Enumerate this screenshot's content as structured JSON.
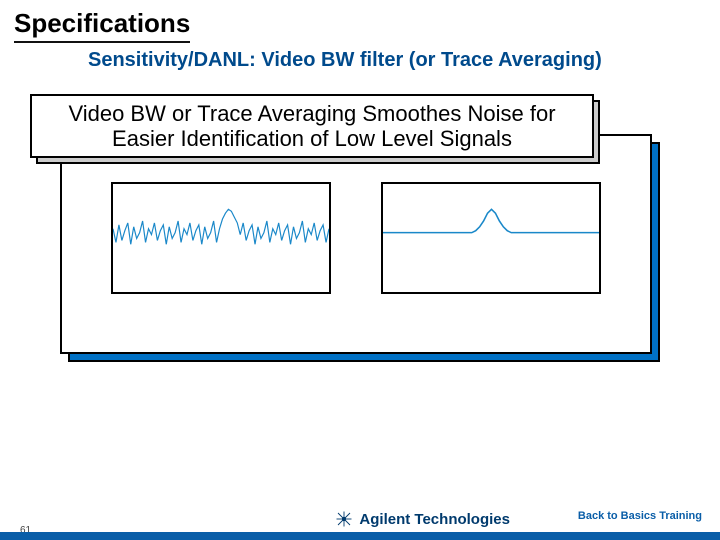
{
  "header": {
    "title": "Specifications",
    "subtitle": "Sensitivity/DANL: Video BW filter (or Trace Averaging)"
  },
  "callout": "Video BW or Trace Averaging Smoothes Noise for Easier Identification of Low Level Signals",
  "footer": {
    "page_number": "61",
    "brand_name": "Agilent Technologies",
    "note": "Back to Basics Training"
  },
  "chart_data": [
    {
      "type": "line",
      "title": "",
      "xlabel": "",
      "ylabel": "",
      "xlim": [
        0,
        219
      ],
      "ylim": [
        0,
        111
      ],
      "series": [
        {
          "name": "noisy-signal",
          "color": "#1a88c9",
          "x": [
            0,
            3,
            6,
            9,
            12,
            15,
            18,
            21,
            24,
            27,
            30,
            33,
            36,
            39,
            42,
            45,
            48,
            51,
            54,
            57,
            60,
            63,
            66,
            69,
            72,
            75,
            78,
            81,
            84,
            87,
            90,
            93,
            96,
            99,
            102,
            105,
            108,
            111,
            114,
            117,
            120,
            123,
            126,
            129,
            132,
            135,
            138,
            141,
            144,
            147,
            150,
            153,
            156,
            159,
            162,
            165,
            168,
            171,
            174,
            177,
            180,
            183,
            186,
            189,
            192,
            195,
            198,
            201,
            204,
            207,
            210,
            213,
            216,
            219
          ],
          "y": [
            46,
            60,
            42,
            58,
            48,
            40,
            62,
            44,
            56,
            50,
            38,
            60,
            46,
            52,
            40,
            58,
            48,
            42,
            62,
            44,
            56,
            50,
            38,
            60,
            46,
            52,
            40,
            58,
            48,
            42,
            62,
            44,
            56,
            50,
            38,
            60,
            46,
            36,
            30,
            26,
            28,
            34,
            40,
            52,
            40,
            58,
            48,
            42,
            62,
            44,
            56,
            50,
            38,
            60,
            46,
            52,
            40,
            58,
            48,
            42,
            62,
            44,
            56,
            50,
            38,
            60,
            46,
            52,
            40,
            58,
            48,
            42,
            60,
            46
          ]
        }
      ]
    },
    {
      "type": "line",
      "title": "",
      "xlabel": "",
      "ylabel": "",
      "xlim": [
        0,
        219
      ],
      "ylim": [
        0,
        111
      ],
      "series": [
        {
          "name": "smoothed-signal",
          "color": "#1a88c9",
          "x": [
            0,
            10,
            20,
            30,
            40,
            50,
            60,
            70,
            80,
            90,
            94,
            98,
            102,
            106,
            110,
            114,
            118,
            122,
            126,
            130,
            140,
            150,
            160,
            170,
            180,
            190,
            200,
            210,
            219
          ],
          "y": [
            50,
            50,
            50,
            50,
            50,
            50,
            50,
            50,
            50,
            50,
            48,
            44,
            38,
            30,
            26,
            30,
            38,
            44,
            48,
            50,
            50,
            50,
            50,
            50,
            50,
            50,
            50,
            50,
            50
          ]
        }
      ]
    }
  ]
}
